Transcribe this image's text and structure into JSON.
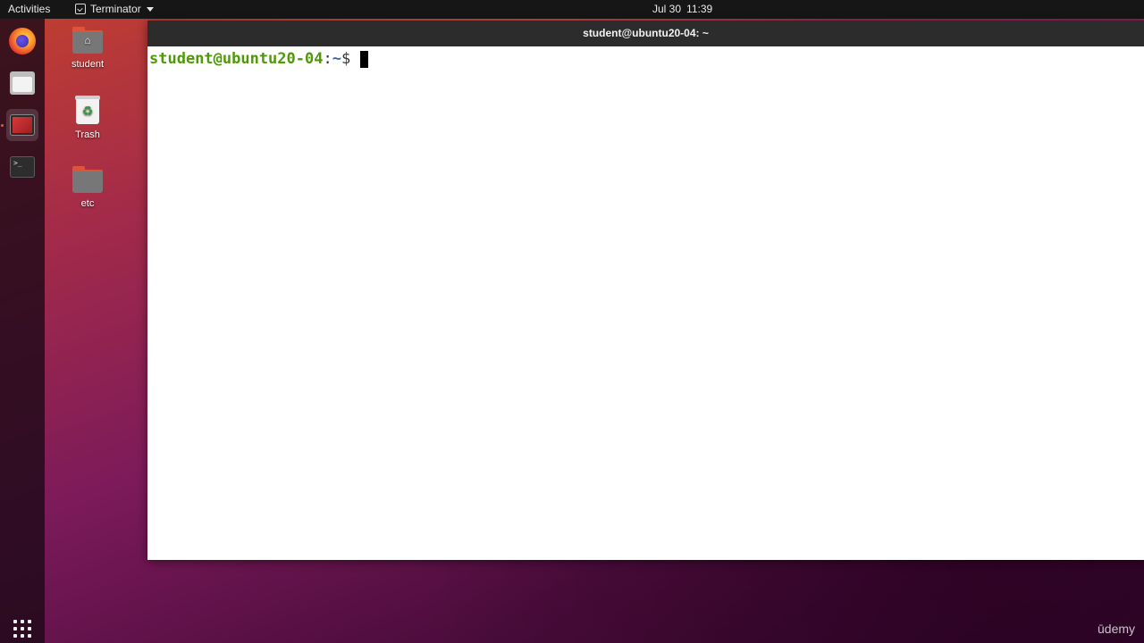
{
  "topbar": {
    "activities": "Activities",
    "app_name": "Terminator",
    "date": "Jul 30",
    "time": "11:39"
  },
  "dock": {
    "items": [
      {
        "name": "firefox",
        "icon": "firefox-icon"
      },
      {
        "name": "files",
        "icon": "files-icon"
      },
      {
        "name": "terminator",
        "icon": "terminator-icon",
        "active": true
      },
      {
        "name": "terminal",
        "icon": "terminal-icon",
        "glyph": ">_"
      }
    ],
    "apps_button": "show-applications-icon"
  },
  "desktop": {
    "icons": [
      {
        "label": "student",
        "icon": "home-folder-icon"
      },
      {
        "label": "Trash",
        "icon": "trash-icon"
      },
      {
        "label": "etc",
        "icon": "folder-icon"
      }
    ]
  },
  "terminal": {
    "title": "student@ubuntu20-04: ~",
    "prompt_user": "student@ubuntu20-04",
    "prompt_sep": ":",
    "prompt_path": "~",
    "prompt_dollar": "$ "
  },
  "colors": {
    "prompt_user": "#4e9a06",
    "prompt_path": "#3465a4",
    "dock_indicator": "#e65a2c",
    "titlebar": "#2c2c2c"
  },
  "watermark": {
    "text": "ūdemy"
  }
}
